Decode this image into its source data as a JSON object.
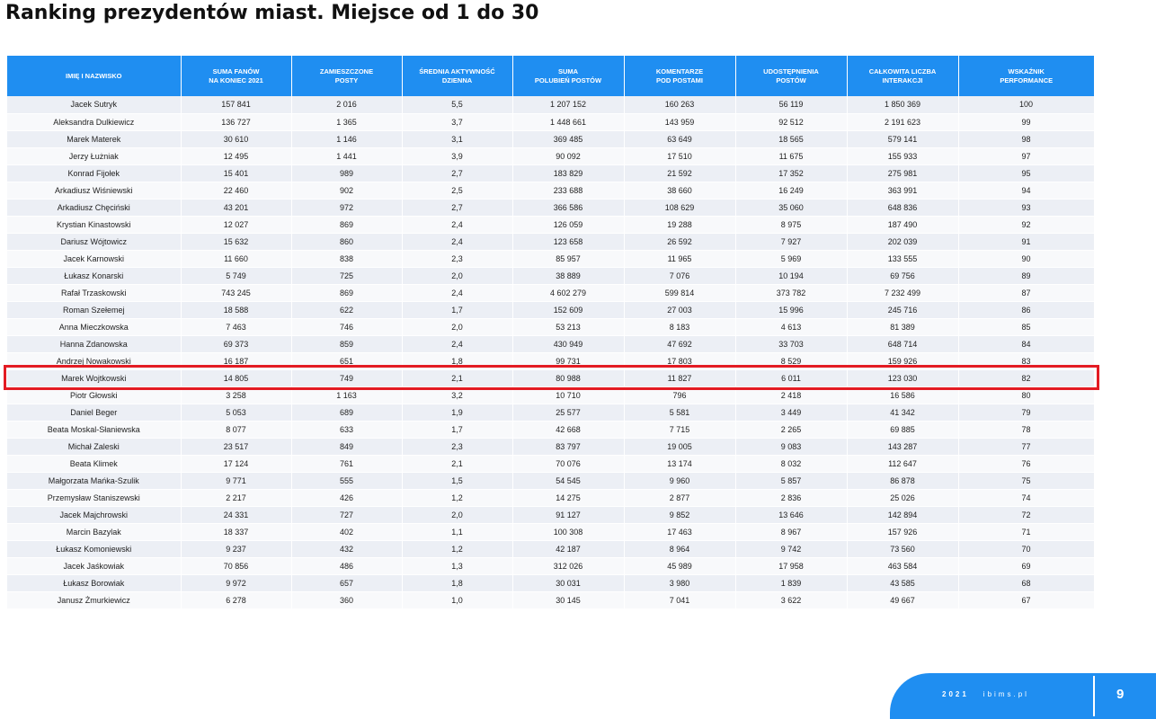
{
  "title": "Ranking prezydentów miast. Miejsce od 1 do 30",
  "colors": {
    "header": "#1f8ef1",
    "highlight": "#e31b23"
  },
  "table": {
    "headers": [
      [
        "IMIĘ I NAZWISKO"
      ],
      [
        "SUMA FANÓW",
        "NA KONIEC 2021"
      ],
      [
        "ZAMIESZCZONE",
        "POSTY"
      ],
      [
        "ŚREDNIA AKTYWNOŚĆ DZIENNA"
      ],
      [
        "SUMA",
        "POLUBIEŃ POSTÓW"
      ],
      [
        "KOMENTARZE",
        "POD POSTAMI"
      ],
      [
        "UDOSTĘPNIENIA",
        "POSTÓW"
      ],
      [
        "CAŁKOWITA LICZBA",
        "INTERAKCJI"
      ],
      [
        "WSKAŹNIK",
        "PERFORMANCE"
      ]
    ],
    "highlighted_row_index": 15,
    "rows": [
      [
        "Jacek Sutryk",
        "157 841",
        "2 016",
        "5,5",
        "1 207 152",
        "160 263",
        "56 119",
        "1 850 369",
        "100"
      ],
      [
        "Aleksandra Dulkiewicz",
        "136 727",
        "1 365",
        "3,7",
        "1 448 661",
        "143 959",
        "92 512",
        "2 191 623",
        "99"
      ],
      [
        "Marek Materek",
        "30 610",
        "1 146",
        "3,1",
        "369 485",
        "63 649",
        "18 565",
        "579 141",
        "98"
      ],
      [
        "Jerzy Łużniak",
        "12 495",
        "1 441",
        "3,9",
        "90 092",
        "17 510",
        "11 675",
        "155 933",
        "97"
      ],
      [
        "Konrad Fijołek",
        "15 401",
        "989",
        "2,7",
        "183 829",
        "21 592",
        "17 352",
        "275 981",
        "95"
      ],
      [
        "Arkadiusz Wiśniewski",
        "22 460",
        "902",
        "2,5",
        "233 688",
        "38 660",
        "16 249",
        "363 991",
        "94"
      ],
      [
        "Arkadiusz Chęciński",
        "43 201",
        "972",
        "2,7",
        "366 586",
        "108 629",
        "35 060",
        "648 836",
        "93"
      ],
      [
        "Krystian Kinastowski",
        "12 027",
        "869",
        "2,4",
        "126 059",
        "19 288",
        "8 975",
        "187 490",
        "92"
      ],
      [
        "Dariusz Wójtowicz",
        "15 632",
        "860",
        "2,4",
        "123 658",
        "26 592",
        "7 927",
        "202 039",
        "91"
      ],
      [
        "Jacek Karnowski",
        "11 660",
        "838",
        "2,3",
        "85 957",
        "11 965",
        "5 969",
        "133 555",
        "90"
      ],
      [
        "Łukasz Konarski",
        "5 749",
        "725",
        "2,0",
        "38 889",
        "7 076",
        "10 194",
        "69 756",
        "89"
      ],
      [
        "Rafał Trzaskowski",
        "743 245",
        "869",
        "2,4",
        "4 602 279",
        "599 814",
        "373 782",
        "7 232 499",
        "87"
      ],
      [
        "Roman Szełemej",
        "18 588",
        "622",
        "1,7",
        "152 609",
        "27 003",
        "15 996",
        "245 716",
        "86"
      ],
      [
        "Anna Mieczkowska",
        "7 463",
        "746",
        "2,0",
        "53 213",
        "8 183",
        "4 613",
        "81 389",
        "85"
      ],
      [
        "Hanna Zdanowska",
        "69 373",
        "859",
        "2,4",
        "430 949",
        "47 692",
        "33 703",
        "648 714",
        "84"
      ],
      [
        "Andrzej Nowakowski",
        "16 187",
        "651",
        "1,8",
        "99 731",
        "17 803",
        "8 529",
        "159 926",
        "83"
      ],
      [
        "Marek Wojtkowski",
        "14 805",
        "749",
        "2,1",
        "80 988",
        "11 827",
        "6 011",
        "123 030",
        "82"
      ],
      [
        "Piotr Głowski",
        "3 258",
        "1 163",
        "3,2",
        "10 710",
        "796",
        "2 418",
        "16 586",
        "80"
      ],
      [
        "Daniel Beger",
        "5 053",
        "689",
        "1,9",
        "25 577",
        "5 581",
        "3 449",
        "41 342",
        "79"
      ],
      [
        "Beata Moskal-Słaniewska",
        "8 077",
        "633",
        "1,7",
        "42 668",
        "7 715",
        "2 265",
        "69 885",
        "78"
      ],
      [
        "Michał Zaleski",
        "23 517",
        "849",
        "2,3",
        "83 797",
        "19 005",
        "9 083",
        "143 287",
        "77"
      ],
      [
        "Beata Klimek",
        "17 124",
        "761",
        "2,1",
        "70 076",
        "13 174",
        "8 032",
        "112 647",
        "76"
      ],
      [
        "Małgorzata Mańka-Szulik",
        "9 771",
        "555",
        "1,5",
        "54 545",
        "9 960",
        "5 857",
        "86 878",
        "75"
      ],
      [
        "Przemysław Staniszewski",
        "2 217",
        "426",
        "1,2",
        "14 275",
        "2 877",
        "2 836",
        "25 026",
        "74"
      ],
      [
        "Jacek Majchrowski",
        "24 331",
        "727",
        "2,0",
        "91 127",
        "9 852",
        "13 646",
        "142 894",
        "72"
      ],
      [
        "Marcin Bazylak",
        "18 337",
        "402",
        "1,1",
        "100 308",
        "17 463",
        "8 967",
        "157 926",
        "71"
      ],
      [
        "Łukasz Komoniewski",
        "9 237",
        "432",
        "1,2",
        "42 187",
        "8 964",
        "9 742",
        "73 560",
        "70"
      ],
      [
        "Jacek Jaśkowiak",
        "70 856",
        "486",
        "1,3",
        "312 026",
        "45 989",
        "17 958",
        "463 584",
        "69"
      ],
      [
        "Łukasz Borowiak",
        "9 972",
        "657",
        "1,8",
        "30 031",
        "3 980",
        "1 839",
        "43 585",
        "68"
      ],
      [
        "Janusz Żmurkiewicz",
        "6 278",
        "360",
        "1,0",
        "30 145",
        "7 041",
        "3 622",
        "49 667",
        "67"
      ]
    ]
  },
  "footer": {
    "year": "2021",
    "site": "ibims.pl",
    "page": "9"
  }
}
